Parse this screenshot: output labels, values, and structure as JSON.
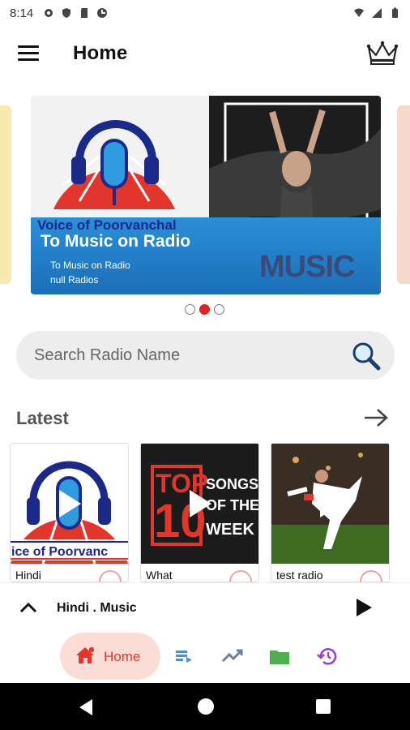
{
  "status_bar": {
    "time": "8:14"
  },
  "app_bar": {
    "title": "Home",
    "menu_icon": "hamburger-menu-icon",
    "premium_icon": "crown-icon"
  },
  "banner": {
    "brand": "Voice of Poorvanchal",
    "title": "To Music on  Radio",
    "subtitle_line1": "To Music on  Radio",
    "subtitle_line2": "null Radios",
    "art_text": "MUSIC"
  },
  "carousel": {
    "page_count": 3,
    "active_index": 1
  },
  "search": {
    "placeholder": "Search Radio Name"
  },
  "latest": {
    "heading": "Latest",
    "items": [
      {
        "label": "Hindi",
        "art_text": "ice of Poorvanc"
      },
      {
        "label": "What",
        "art_text_top": "TOP",
        "art_text_num": "10",
        "art_text_songs": "SONGS OF THE WEEK"
      },
      {
        "label": "test radio"
      }
    ]
  },
  "mini_player": {
    "title": "Hindi . Music"
  },
  "bottom_nav": {
    "home_label": "Home",
    "accent": "#e2352b",
    "items": [
      "home-icon",
      "queue-icon",
      "trending-icon",
      "folder-icon",
      "history-icon"
    ]
  }
}
